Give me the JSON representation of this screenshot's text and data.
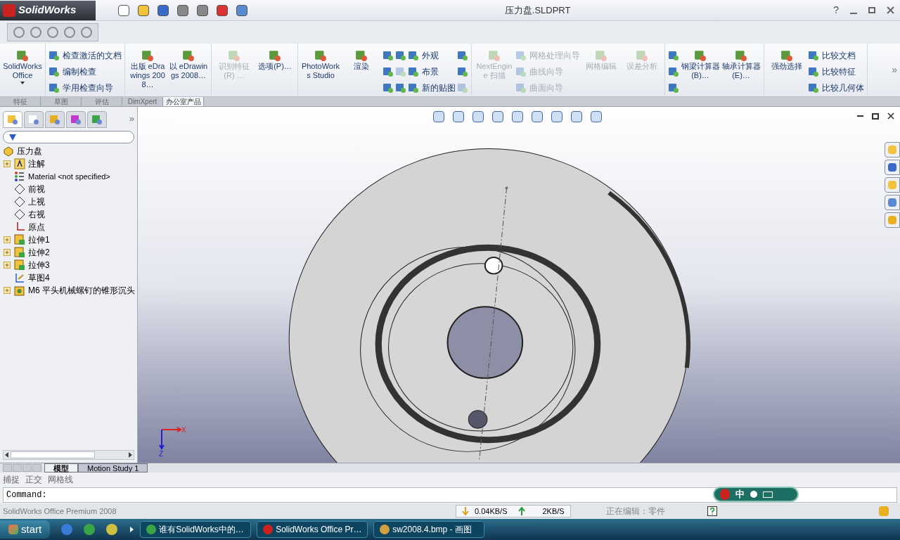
{
  "titlebar": {
    "app": "SolidWorks",
    "title": "压力盘.SLDPRT",
    "help": "?"
  },
  "ribbon": [
    {
      "columns": [
        {
          "kind": "large",
          "label": "SolidWorks Office",
          "disabled": false,
          "dropdown": true
        }
      ]
    },
    {
      "columns": [
        {
          "kind": "stack",
          "items": [
            {
              "label": "检查激活的文档",
              "disabled": false
            },
            {
              "label": "编制检查",
              "disabled": false
            },
            {
              "label": "学用检查向导",
              "disabled": false
            }
          ]
        }
      ]
    },
    {
      "columns": [
        {
          "kind": "large",
          "label": "出版 eDrawings 2008…",
          "disabled": false,
          "dropdown": false
        },
        {
          "kind": "large",
          "label": "以 eDrawings 2008…",
          "disabled": false,
          "dropdown": false
        }
      ]
    },
    {
      "columns": [
        {
          "kind": "large",
          "label": "识别特征(R) …",
          "disabled": true,
          "dropdown": false
        },
        {
          "kind": "large",
          "label": "选项(P)…",
          "disabled": false,
          "dropdown": false
        }
      ]
    },
    {
      "columns": [
        {
          "kind": "large",
          "label": "PhotoWorks Studio",
          "disabled": false,
          "dropdown": false
        },
        {
          "kind": "large",
          "label": "渲染",
          "disabled": false,
          "dropdown": false
        },
        {
          "kind": "stack",
          "items": [
            {
              "disabled": false
            },
            {
              "disabled": false
            },
            {
              "disabled": false
            }
          ]
        },
        {
          "kind": "stack",
          "items": [
            {
              "disabled": false
            },
            {
              "disabled": true
            },
            {
              "disabled": false
            }
          ]
        },
        {
          "kind": "stack",
          "items": [
            {
              "label": "外观",
              "disabled": false
            },
            {
              "label": "布景",
              "disabled": false
            },
            {
              "label": "新的贴图",
              "disabled": false
            }
          ]
        },
        {
          "kind": "stack",
          "items": [
            {
              "disabled": false
            },
            {
              "disabled": false
            },
            {
              "disabled": true
            }
          ]
        }
      ]
    },
    {
      "columns": [
        {
          "kind": "large",
          "label": "NextEngine 扫描",
          "disabled": true,
          "dropdown": false
        },
        {
          "kind": "stack",
          "items": [
            {
              "label": "网格处理向导",
              "disabled": true
            },
            {
              "label": "曲线向导",
              "disabled": true
            },
            {
              "label": "曲面向导",
              "disabled": true
            }
          ]
        },
        {
          "kind": "large",
          "label": "网格编辑",
          "disabled": true,
          "dropdown": false
        },
        {
          "kind": "large",
          "label": "误差分析",
          "disabled": true,
          "dropdown": false
        }
      ]
    },
    {
      "columns": [
        {
          "kind": "stack",
          "items": [
            {
              "disabled": false
            },
            {
              "disabled": false
            },
            {
              "disabled": false
            }
          ]
        },
        {
          "kind": "large",
          "label": "钢梁计算器(B)…",
          "disabled": false,
          "dropdown": false
        },
        {
          "kind": "large",
          "label": "轴承计算器(E)…",
          "disabled": false,
          "dropdown": false
        }
      ]
    },
    {
      "columns": [
        {
          "kind": "large",
          "label": "强劲选择",
          "disabled": false,
          "dropdown": false
        },
        {
          "kind": "stack",
          "items": [
            {
              "label": "比较文档",
              "disabled": false
            },
            {
              "label": "比较特征",
              "disabled": false
            },
            {
              "label": "比较几何体",
              "disabled": false
            }
          ]
        }
      ]
    }
  ],
  "ribbon_more": "»",
  "command_tabs": [
    {
      "label": "特征",
      "selected": false
    },
    {
      "label": "草图",
      "selected": false
    },
    {
      "label": "评估",
      "selected": false
    },
    {
      "label": "DimXpert",
      "selected": false
    },
    {
      "label": "办公室产品",
      "selected": true
    }
  ],
  "panel_tabs": [
    {
      "kind": "feature",
      "selected": true
    },
    {
      "kind": "property",
      "selected": false
    },
    {
      "kind": "config",
      "selected": false
    },
    {
      "kind": "dim",
      "selected": false
    },
    {
      "kind": "display",
      "selected": false
    }
  ],
  "panel_more": "»",
  "tree": {
    "label": "压力盘",
    "kind": "part",
    "children": [
      {
        "label": "注解",
        "kind": "annotation",
        "collapsed": true
      },
      {
        "label": "Material <not specified>",
        "kind": "material",
        "collapsed": false
      },
      {
        "label": "前视",
        "kind": "plane",
        "collapsed": false
      },
      {
        "label": "上视",
        "kind": "plane",
        "collapsed": false
      },
      {
        "label": "右视",
        "kind": "plane",
        "collapsed": false
      },
      {
        "label": "原点",
        "kind": "origin",
        "collapsed": false
      },
      {
        "label": "拉伸1",
        "kind": "extrude",
        "collapsed": true
      },
      {
        "label": "拉伸2",
        "kind": "extrude",
        "collapsed": true
      },
      {
        "label": "拉伸3",
        "kind": "extrude",
        "collapsed": true
      },
      {
        "label": "草图4",
        "kind": "sketch",
        "collapsed": false
      },
      {
        "label": "M6 平头机械螺钉的锥形沉头",
        "kind": "hole",
        "collapsed": true
      }
    ]
  },
  "triad": {
    "x": "X",
    "z": "Z"
  },
  "bottom_tabs": [
    {
      "label": "模型",
      "selected": true
    },
    {
      "label": "Motion Study 1",
      "selected": false
    }
  ],
  "toggles": [
    "捕捉",
    "正交",
    "网格线"
  ],
  "command_line": {
    "prompt": "Command:"
  },
  "status": {
    "text": "SolidWorks Office Premium 2008",
    "download": "0.04KB/S",
    "upload": "2KB/S",
    "state": "正在编辑：零件"
  },
  "ime": {
    "mode": "中"
  },
  "taskbar": {
    "start": "start",
    "tasks": [
      {
        "label": "谁有SolidWorks中的…",
        "kind": "chat"
      },
      {
        "label": "SolidWorks Office Pr…",
        "kind": "solidworks"
      },
      {
        "label": "sw2008.4.bmp - 画图",
        "kind": "paint"
      }
    ]
  }
}
